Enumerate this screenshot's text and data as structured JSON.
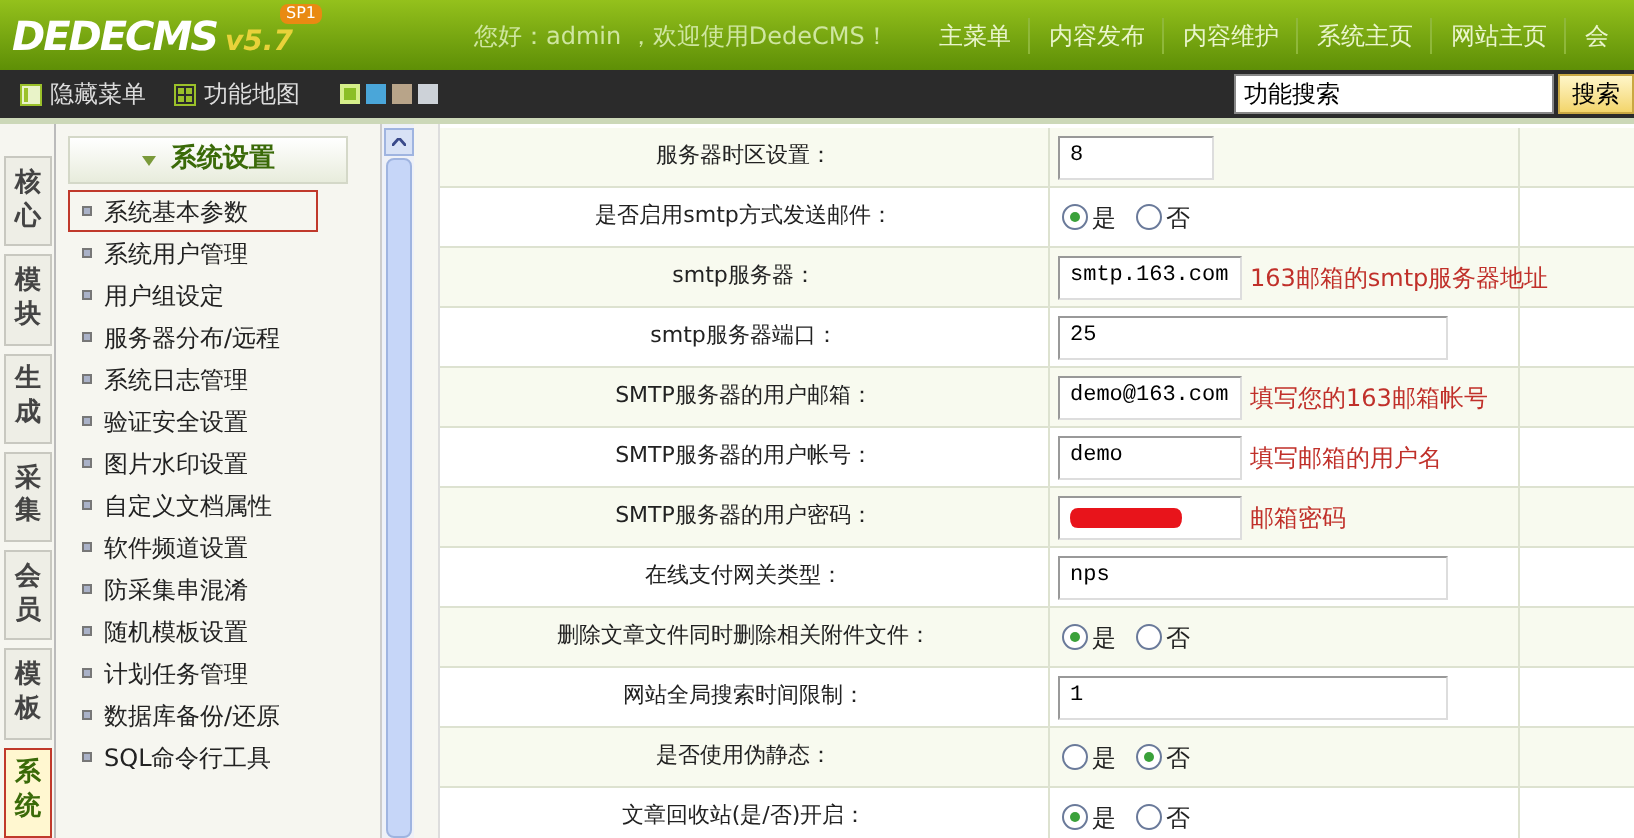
{
  "header": {
    "logo": "DEDECMS",
    "version": "v5.7",
    "badge": "SP1",
    "greeting": "您好：admin ，欢迎使用DedeCMS！",
    "nav": [
      "主菜单",
      "内容发布",
      "内容维护",
      "系统主页",
      "网站主页",
      "会"
    ]
  },
  "toolbar": {
    "hide_menu": "隐藏菜单",
    "function_map": "功能地图",
    "themes": [
      {
        "color": "#8cbf26",
        "selected": true
      },
      {
        "color": "#4aa6d9",
        "selected": false
      },
      {
        "color": "#b8a489",
        "selected": false
      },
      {
        "color": "#cdd2d8",
        "selected": false
      }
    ],
    "search": {
      "value": "功能搜索",
      "button": "搜索"
    }
  },
  "side_tabs": [
    {
      "label": "核心",
      "selected": false
    },
    {
      "label": "模块",
      "selected": false
    },
    {
      "label": "生成",
      "selected": false
    },
    {
      "label": "采集",
      "selected": false
    },
    {
      "label": "会员",
      "selected": false
    },
    {
      "label": "模板",
      "selected": false
    },
    {
      "label": "系统",
      "selected": true
    }
  ],
  "menu": {
    "title": "系统设置",
    "items": [
      {
        "label": "系统基本参数",
        "selected": true
      },
      {
        "label": "系统用户管理",
        "selected": false
      },
      {
        "label": "用户组设定",
        "selected": false
      },
      {
        "label": "服务器分布/远程",
        "selected": false
      },
      {
        "label": "系统日志管理",
        "selected": false
      },
      {
        "label": "验证安全设置",
        "selected": false
      },
      {
        "label": "图片水印设置",
        "selected": false
      },
      {
        "label": "自定义文档属性",
        "selected": false
      },
      {
        "label": "软件频道设置",
        "selected": false
      },
      {
        "label": "防采集串混淆",
        "selected": false
      },
      {
        "label": "随机模板设置",
        "selected": false
      },
      {
        "label": "计划任务管理",
        "selected": false
      },
      {
        "label": "数据库备份/还原",
        "selected": false
      },
      {
        "label": "SQL命令行工具",
        "selected": false
      }
    ]
  },
  "settings": [
    {
      "label": "服务器时区设置：",
      "kind": "text",
      "value": "8",
      "short": true
    },
    {
      "label": "是否启用smtp方式发送邮件：",
      "kind": "radio",
      "options": [
        {
          "label": "是",
          "selected": true
        },
        {
          "label": "否",
          "selected": false
        }
      ]
    },
    {
      "label": "smtp服务器：",
      "kind": "text",
      "value": "smtp.163.com",
      "annotation": "163邮箱的smtp服务器地址"
    },
    {
      "label": "smtp服务器端口：",
      "kind": "text",
      "value": "25"
    },
    {
      "label": "SMTP服务器的用户邮箱：",
      "kind": "text",
      "value": "demo@163.com",
      "annotation": "填写您的163邮箱帐号"
    },
    {
      "label": "SMTP服务器的用户帐号：",
      "kind": "text",
      "value": "demo",
      "annotation": "填写邮箱的用户名"
    },
    {
      "label": "SMTP服务器的用户密码：",
      "kind": "password",
      "annotation": "邮箱密码"
    },
    {
      "label": "在线支付网关类型：",
      "kind": "text",
      "value": "nps"
    },
    {
      "label": "删除文章文件同时删除相关附件文件：",
      "kind": "radio",
      "options": [
        {
          "label": "是",
          "selected": true
        },
        {
          "label": "否",
          "selected": false
        }
      ]
    },
    {
      "label": "网站全局搜索时间限制：",
      "kind": "text",
      "value": "1"
    },
    {
      "label": "是否使用伪静态：",
      "kind": "radio",
      "options": [
        {
          "label": "是",
          "selected": false
        },
        {
          "label": "否",
          "selected": true
        }
      ]
    },
    {
      "label": "文章回收站(是/否)开启：",
      "kind": "radio",
      "options": [
        {
          "label": "是",
          "selected": true
        },
        {
          "label": "否",
          "selected": false
        }
      ]
    }
  ]
}
